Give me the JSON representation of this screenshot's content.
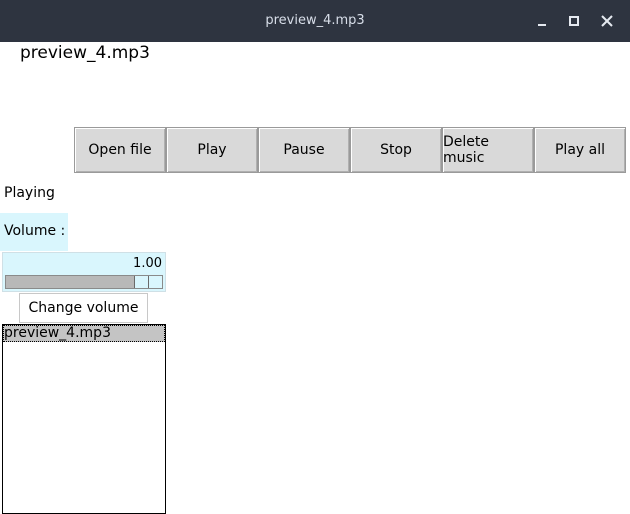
{
  "window": {
    "title": "preview_4.mp3",
    "controls": [
      "minimize-icon",
      "maximize-icon",
      "close-icon"
    ]
  },
  "header": {
    "current_file": "preview_4.mp3"
  },
  "toolbar": {
    "open_label": "Open file",
    "play_label": "Play",
    "pause_label": "Pause",
    "stop_label": "Stop",
    "delete_label": "Delete music",
    "play_all_label": "Play all"
  },
  "status": {
    "text": "Playing"
  },
  "volume": {
    "label": "Volume :",
    "value_text": "1.00",
    "value": 1.0,
    "change_label": "Change volume",
    "accent_color": "#d9f6fd"
  },
  "playlist": {
    "items": [
      {
        "name": "preview_4.mp3",
        "selected": true
      }
    ]
  }
}
